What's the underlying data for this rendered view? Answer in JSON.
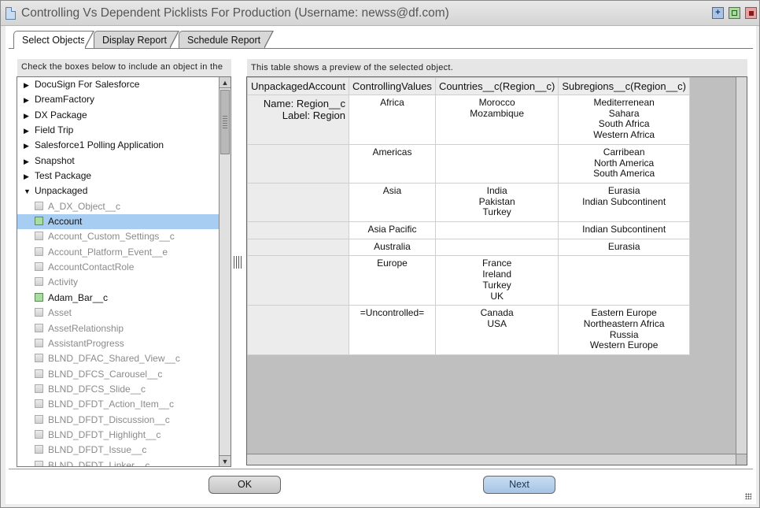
{
  "window": {
    "title": "Controlling Vs Dependent Picklists For Production (Username: newss@df.com)",
    "icon": "document-icon",
    "controls": [
      {
        "name": "add",
        "icon": "plus-icon"
      },
      {
        "name": "maximize",
        "icon": "maximize-icon"
      },
      {
        "name": "close",
        "icon": "close-icon"
      }
    ]
  },
  "tabs": [
    {
      "label": "Select Objects",
      "active": true
    },
    {
      "label": "Display Report",
      "active": false
    },
    {
      "label": "Schedule Report",
      "active": false
    }
  ],
  "left_panel": {
    "header": "Check the boxes below to include an object in the",
    "groups": [
      {
        "label": "DocuSign For Salesforce",
        "expanded": false
      },
      {
        "label": "DreamFactory",
        "expanded": false
      },
      {
        "label": "DX Package",
        "expanded": false
      },
      {
        "label": "Field Trip",
        "expanded": false
      },
      {
        "label": "Salesforce1 Polling Application",
        "expanded": false
      },
      {
        "label": "Snapshot",
        "expanded": false
      },
      {
        "label": "Test Package",
        "expanded": false
      },
      {
        "label": "Unpackaged",
        "expanded": true
      }
    ],
    "objects": [
      {
        "label": "A_DX_Object__c",
        "checked": false,
        "selected": false
      },
      {
        "label": "Account",
        "checked": true,
        "selected": true
      },
      {
        "label": "Account_Custom_Settings__c",
        "checked": false,
        "selected": false
      },
      {
        "label": "Account_Platform_Event__e",
        "checked": false,
        "selected": false
      },
      {
        "label": "AccountContactRole",
        "checked": false,
        "selected": false
      },
      {
        "label": "Activity",
        "checked": false,
        "selected": false
      },
      {
        "label": "Adam_Bar__c",
        "checked": true,
        "selected": false
      },
      {
        "label": "Asset",
        "checked": false,
        "selected": false
      },
      {
        "label": "AssetRelationship",
        "checked": false,
        "selected": false
      },
      {
        "label": "AssistantProgress",
        "checked": false,
        "selected": false
      },
      {
        "label": "BLND_DFAC_Shared_View__c",
        "checked": false,
        "selected": false
      },
      {
        "label": "BLND_DFCS_Carousel__c",
        "checked": false,
        "selected": false
      },
      {
        "label": "BLND_DFCS_Slide__c",
        "checked": false,
        "selected": false
      },
      {
        "label": "BLND_DFDT_Action_Item__c",
        "checked": false,
        "selected": false
      },
      {
        "label": "BLND_DFDT_Discussion__c",
        "checked": false,
        "selected": false
      },
      {
        "label": "BLND_DFDT_Highlight__c",
        "checked": false,
        "selected": false
      },
      {
        "label": "BLND_DFDT_Issue__c",
        "checked": false,
        "selected": false
      },
      {
        "label": "BLND_DFDT_Linker__c",
        "checked": false,
        "selected": false
      }
    ]
  },
  "right_panel": {
    "header": "This table shows a preview of the selected object.",
    "table": {
      "columns": [
        [
          "Unpackaged",
          "Account"
        ],
        [
          "Controlling",
          "Values"
        ],
        [
          "Countries__c",
          "(Region__c)"
        ],
        [
          "Subregions__c",
          "(Region__c)"
        ]
      ],
      "field_info": [
        "Name: Region__c",
        "Label: Region"
      ],
      "rows": [
        {
          "controlling": "Africa",
          "countries": [
            "Morocco",
            "Mozambique"
          ],
          "subregions": [
            "Mediterrenean",
            "Sahara",
            "South Africa",
            "Western Africa"
          ]
        },
        {
          "controlling": "Americas",
          "countries": [],
          "subregions": [
            "Carribean",
            "North America",
            "South America"
          ]
        },
        {
          "controlling": "Asia",
          "countries": [
            "India",
            "Pakistan",
            "Turkey"
          ],
          "subregions": [
            "Eurasia",
            "Indian Subcontinent"
          ]
        },
        {
          "controlling": "Asia Pacific",
          "countries": [],
          "subregions": [
            "Indian Subcontinent"
          ]
        },
        {
          "controlling": "Australia",
          "countries": [],
          "subregions": [
            "Eurasia"
          ]
        },
        {
          "controlling": "Europe",
          "countries": [
            "France",
            "Ireland",
            "Turkey",
            "UK"
          ],
          "subregions": []
        },
        {
          "controlling": "=Uncontrolled=",
          "countries": [
            "Canada",
            "USA"
          ],
          "subregions": [
            "Eastern Europe",
            "Northeastern Africa",
            "Russia",
            "Western Europe"
          ]
        }
      ]
    }
  },
  "buttons": {
    "ok": "OK",
    "next": "Next"
  }
}
